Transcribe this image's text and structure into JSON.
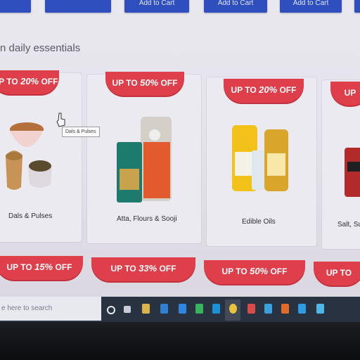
{
  "top_row": {
    "add_to_cart_labels": [
      "Add to Cart",
      "Add to Cart",
      "Add to Cart"
    ]
  },
  "section": {
    "title": "n daily essentials"
  },
  "cards": [
    {
      "discount_prefix": "UP TO",
      "discount_value": "20%",
      "discount_suffix": "OFF",
      "label": "Dals & Pulses"
    },
    {
      "discount_prefix": "UP TO",
      "discount_value": "50%",
      "discount_suffix": "OFF",
      "label": "Atta, Flours & Sooji"
    },
    {
      "discount_prefix": "UP TO",
      "discount_value": "20%",
      "discount_suffix": "OFF",
      "label": "Edible Oils"
    },
    {
      "discount_prefix": "UP",
      "label": "Salt, Sug"
    }
  ],
  "second_row": [
    {
      "discount_prefix": "UP TO",
      "discount_value": "15%",
      "discount_suffix": "OFF"
    },
    {
      "discount_prefix": "UP TO",
      "discount_value": "33%",
      "discount_suffix": "OFF"
    },
    {
      "discount_prefix": "UP TO",
      "discount_value": "50%",
      "discount_suffix": "OFF"
    },
    {
      "discount_prefix": "UP TO"
    }
  ],
  "tooltip": {
    "text": "Dals & Pulses"
  },
  "taskbar": {
    "search_placeholder": "e here to search"
  },
  "colors": {
    "ribbon": "#df3e4b",
    "cart_button": "#2f4fbf",
    "taskbar": "#283240"
  }
}
